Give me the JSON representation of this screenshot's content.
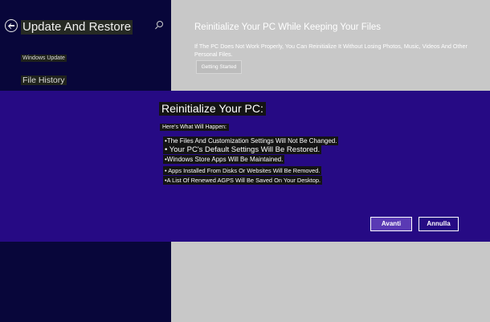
{
  "sidebar": {
    "title": "Update And Restore",
    "items": [
      {
        "label": "Windows Update"
      },
      {
        "label": "File History"
      }
    ]
  },
  "content": {
    "title": "Reinitialize Your PC While Keeping Your Files",
    "description": "If The PC Does Not Work Properly, You Can Reinitialize It Without Losing Photos, Music, Videos And Other Personal Files.",
    "button_label": "Getting Started"
  },
  "dialog": {
    "title": "Reinitialize Your PC:",
    "subtitle": "Here's What Will Happen:",
    "bullets": [
      "•The Files And Customization Settings Will Not Be Changed.",
      "• Your PC's Default Settings Will Be Restored.",
      "•Windows Store Apps Will Be Maintained.",
      "• Apps Installed From Disks Or Websites Will Be Removed.",
      "•A List Of Renewed AGPS Will Be Saved On Your Desktop."
    ],
    "primary_button": "Avanti",
    "secondary_button": "Annulla"
  },
  "colors": {
    "sidebar_bg": "#08063a",
    "dialog_bg": "#260a84",
    "content_bg": "#c8c8c8",
    "primary_button_bg": "#5a3ab4"
  },
  "icons": {
    "back": "back-arrow-icon",
    "search": "search-icon"
  }
}
